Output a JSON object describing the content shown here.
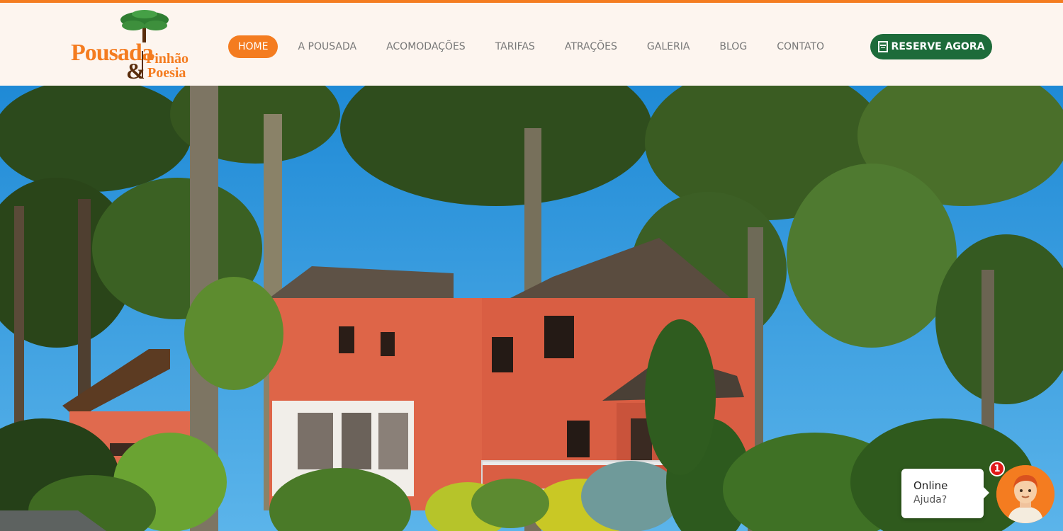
{
  "brand": {
    "logo_main": "Pousada",
    "logo_amp": "&",
    "logo_line1": "Pinhão",
    "logo_line2": "Poesia",
    "accent_color": "#f47c20",
    "green_color": "#1d6b3a"
  },
  "nav": {
    "items": [
      {
        "label": "HOME",
        "active": true
      },
      {
        "label": "A POUSADA"
      },
      {
        "label": "ACOMODAÇÕES"
      },
      {
        "label": "TARIFAS"
      },
      {
        "label": "ATRAÇÕES"
      },
      {
        "label": "GALERIA"
      },
      {
        "label": "BLOG"
      },
      {
        "label": "CONTATO"
      }
    ],
    "cta": {
      "label": "RESERVE AGORA",
      "icon": "calendar-icon"
    }
  },
  "hero": {
    "image": "pousada-building-among-araucaria-trees"
  },
  "chat": {
    "status": "Online",
    "prompt": "Ajuda?",
    "badge_count": "1",
    "avatar_icon": "attendant-avatar-icon"
  }
}
